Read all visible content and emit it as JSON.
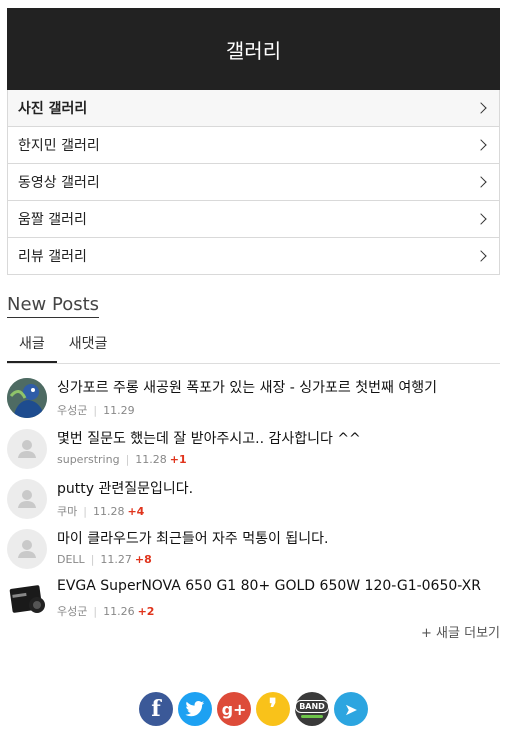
{
  "header": {
    "title": "갤러리"
  },
  "menu": {
    "items": [
      {
        "label": "사진 갤러리"
      },
      {
        "label": "한지민 갤러리"
      },
      {
        "label": "동영상 갤러리"
      },
      {
        "label": "움짤 갤러리"
      },
      {
        "label": "리뷰 갤러리"
      }
    ]
  },
  "new_posts": {
    "title": "New Posts",
    "tabs": [
      {
        "label": "새글"
      },
      {
        "label": "새댓글"
      }
    ],
    "posts": [
      {
        "title": "싱가포르 주롱 새공원 폭포가 있는 새장 - 싱가포르 첫번째 여행기",
        "author": "우성군",
        "date": "11.29",
        "comments": ""
      },
      {
        "title": "몇번 질문도 했는데 잘 받아주시고.. 감사합니다 ^^",
        "author": "superstring",
        "date": "11.28",
        "comments": "+1"
      },
      {
        "title": "putty 관련질문입니다.",
        "author": "쿠마",
        "date": "11.28",
        "comments": "+4"
      },
      {
        "title": "마이 클라우드가 최근들어 자주 먹통이 됩니다.",
        "author": "DELL",
        "date": "11.27",
        "comments": "+8"
      },
      {
        "title": "EVGA SuperNOVA 650 G1 80+ GOLD 650W 120-G1-0650-XR",
        "author": "우성군",
        "date": "11.26",
        "comments": "+2"
      }
    ],
    "more_label": "+ 새글 더보기"
  },
  "share": {
    "facebook": {
      "glyph": "f",
      "color": "#3b5998"
    },
    "twitter": {
      "glyph": "t",
      "color": "#1da1f2"
    },
    "googleplus": {
      "glyph": "g+",
      "color": "#dd4b39"
    },
    "kakaostory": {
      "glyph": "❜",
      "color": "#f9c21a"
    },
    "band": {
      "glyph": "BAND",
      "color": "#3a3a3a"
    },
    "telegram": {
      "glyph": "➤",
      "color": "#2ca5e0"
    }
  }
}
